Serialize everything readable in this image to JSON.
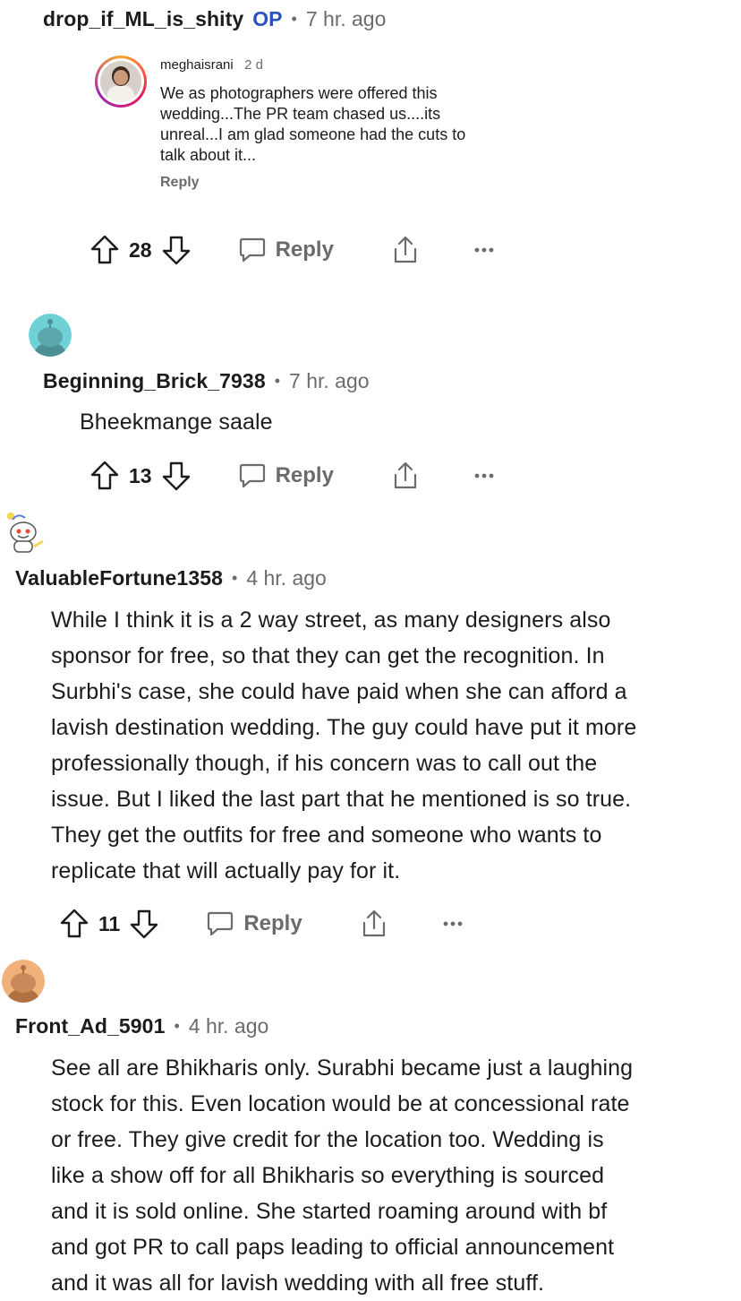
{
  "comments": [
    {
      "username": "drop_if_ML_is_shity",
      "op_badge": "OP",
      "separator": "•",
      "time": "7 hr. ago",
      "embed": {
        "username": "meghaisrani",
        "time": "2 d",
        "text_lines": [
          "We as photographers were offered this",
          "wedding...The PR team chased us....its",
          "unreal...I am glad someone had the cuts to",
          "talk about it..."
        ],
        "reply_label": "Reply"
      },
      "votes": "28",
      "reply_label": "Reply"
    },
    {
      "username": "Beginning_Brick_7938",
      "separator": "•",
      "time": "7 hr. ago",
      "text": "Bheekmange saale",
      "votes": "13",
      "reply_label": "Reply",
      "avatar_color": "#6fd0d6"
    },
    {
      "username": "ValuableFortune1358",
      "separator": "•",
      "time": "4 hr. ago",
      "text_lines": [
        "While I think it is a 2 way street, as many designers also",
        "sponsor for free, so that they can get the recognition. In",
        "Surbhi's case, she could have paid when she can afford a",
        "lavish destination wedding. The guy could have put it more",
        "professionally though, if his concern was to call out the",
        "issue. But I liked the last part that he mentioned is so true.",
        "They get the outfits for free and someone who wants to",
        "replicate that will actually pay for it."
      ],
      "votes": "11",
      "reply_label": "Reply"
    },
    {
      "username": "Front_Ad_5901",
      "separator": "•",
      "time": "4 hr. ago",
      "text_lines": [
        "See all are Bhikharis only. Surabhi became just a laughing",
        "stock for this. Even location would be at concessional rate",
        "or free. They give credit for the location too. Wedding is",
        "like a show off for all Bhikharis so everything is sourced",
        "and it is sold online. She started roaming around with bf",
        "and got PR to call paps leading to official announcement",
        "and it was all for lavish wedding with all free stuff."
      ],
      "avatar_color": "#f0b27a"
    }
  ],
  "colors": {
    "text": "#1c1c1c",
    "muted": "#6b6b6b",
    "op": "#2a52be"
  }
}
